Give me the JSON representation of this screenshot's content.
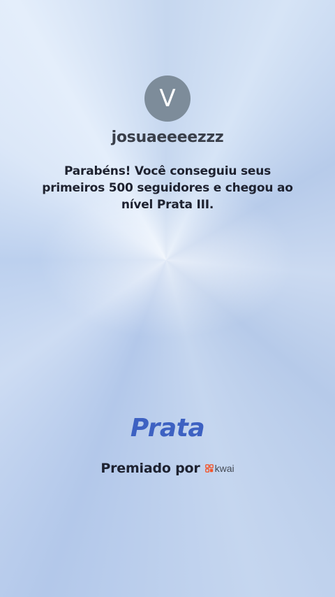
{
  "profile": {
    "avatar_letter": "V",
    "username": "josuaeeeezzz"
  },
  "achievement": {
    "message": "Parabéns! Você conseguiu seus primeiros 500 seguidores e chegou ao nível Prata III.",
    "tier_title": "Prata"
  },
  "footer": {
    "awarded_by": "Premiado por",
    "brand_name": "kwai",
    "brand_icon": "kwai-logo-icon"
  },
  "colors": {
    "avatar_bg": "#7d8c9a",
    "tier_title": "#3d61c2",
    "brand_icon": "#f2552c"
  }
}
